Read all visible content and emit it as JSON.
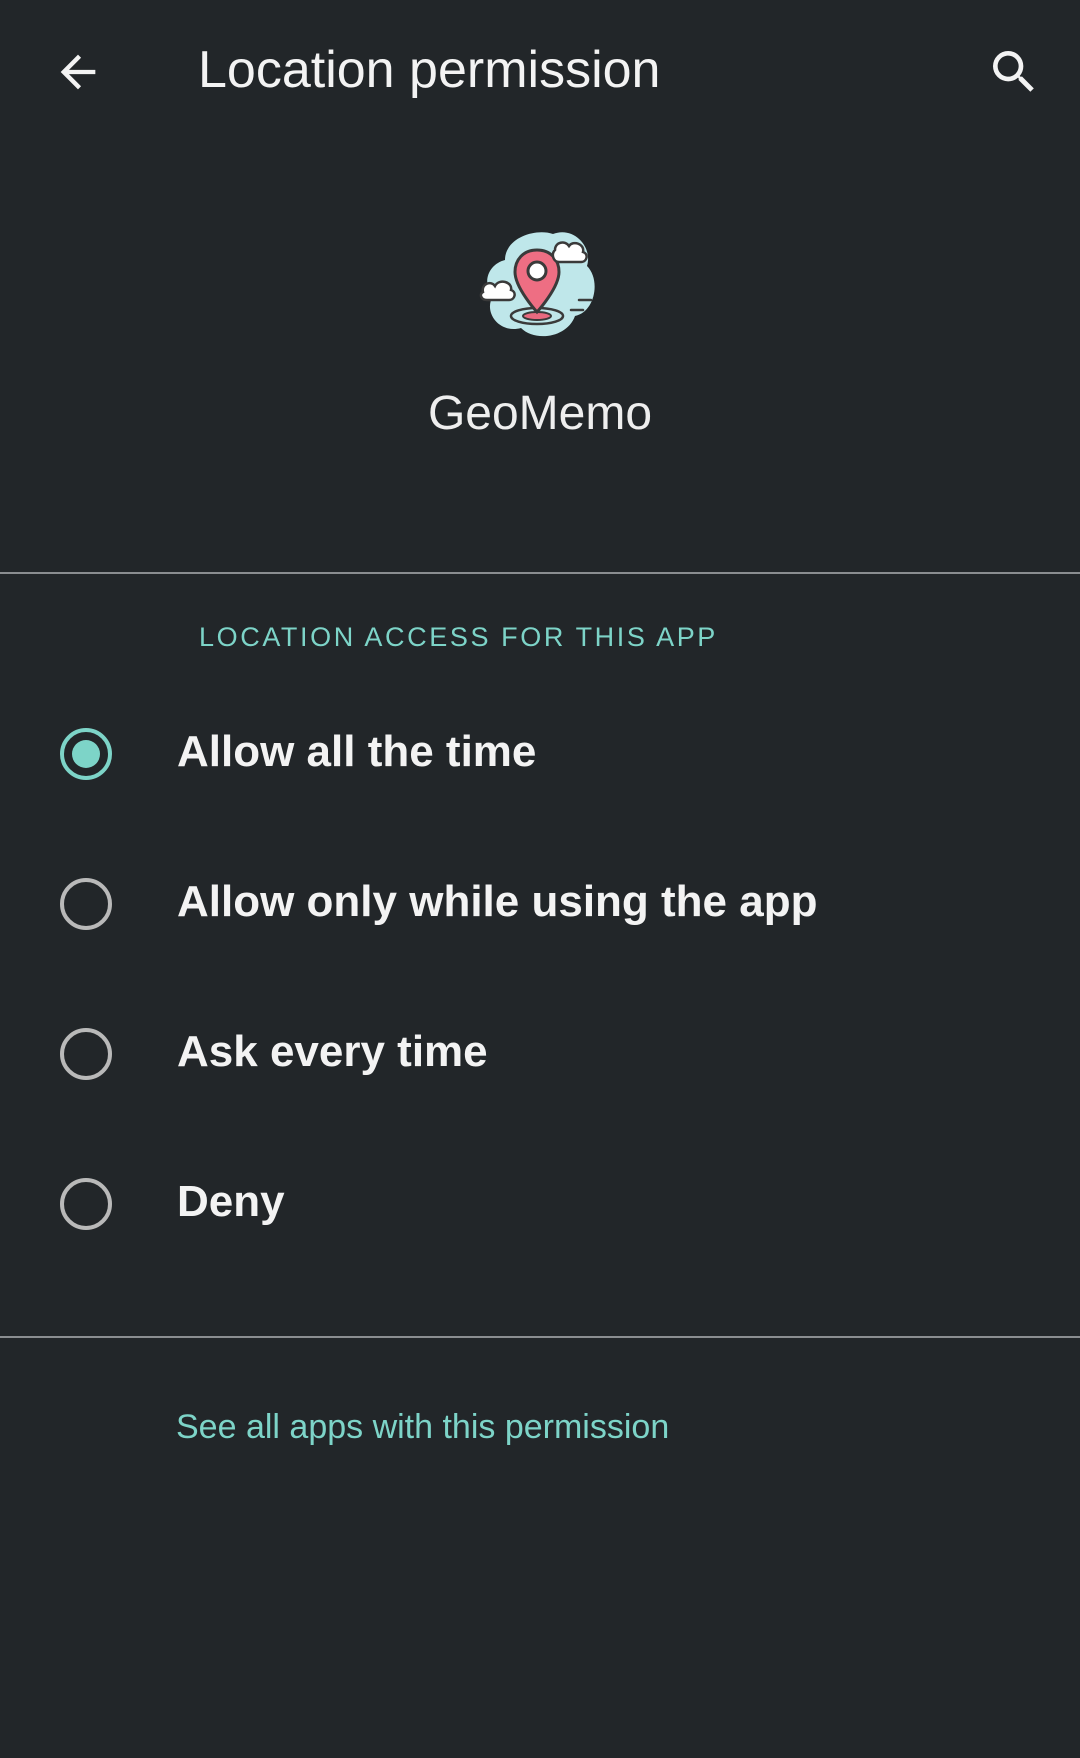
{
  "colors": {
    "background": "#222629",
    "accent": "#7dd4c8",
    "text": "#f3f3f3",
    "radio_unchecked": "#b9b9b9",
    "divider": "#8a8d90"
  },
  "toolbar": {
    "back_icon": "arrow-left-icon",
    "title": "Location permission",
    "search_icon": "search-icon"
  },
  "app": {
    "icon": "map-pin-cloud-icon",
    "name": "GeoMemo"
  },
  "section": {
    "header": "LOCATION ACCESS FOR THIS APP"
  },
  "options": [
    {
      "label": "Allow all the time",
      "selected": true
    },
    {
      "label": "Allow only while using the app",
      "selected": false
    },
    {
      "label": "Ask every time",
      "selected": false
    },
    {
      "label": "Deny",
      "selected": false
    }
  ],
  "footer": {
    "link_label": "See all apps with this permission"
  }
}
